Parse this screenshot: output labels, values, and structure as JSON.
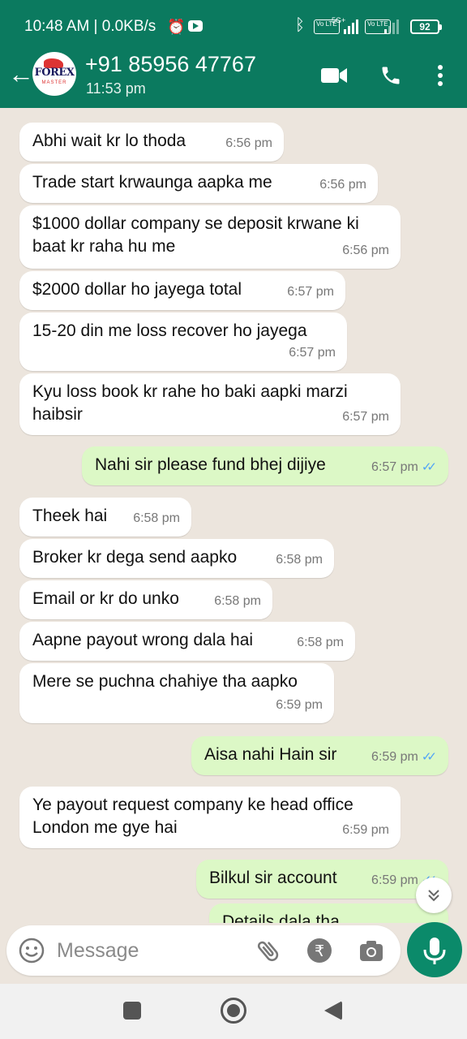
{
  "status_bar": {
    "time": "10:48 AM | 0.0KB/s",
    "network": "5G+",
    "volte1": "Vo LTE",
    "volte2": "Vo LTE",
    "battery": "92"
  },
  "header": {
    "contact_name": "+91 85956 47767",
    "last_seen": "11:53 pm",
    "avatar_logo": "FOREX",
    "avatar_sub": "MASTER"
  },
  "messages": [
    {
      "dir": "in",
      "text": "Abhi wait kr lo thoda",
      "time": "6:56 pm"
    },
    {
      "dir": "in",
      "text": "Trade start krwaunga aapka me",
      "time": "6:56 pm"
    },
    {
      "dir": "in",
      "text": "$1000 dollar company se deposit krwane ki baat kr raha hu me",
      "time": "6:56 pm"
    },
    {
      "dir": "in",
      "text": "$2000 dollar ho jayega total",
      "time": "6:57 pm"
    },
    {
      "dir": "in",
      "text": "15-20 din me loss recover ho jayega",
      "time": "6:57 pm"
    },
    {
      "dir": "in",
      "text": "Kyu loss book kr rahe ho baki aapki marzi haibsir",
      "time": "6:57 pm"
    },
    {
      "dir": "out",
      "text": "Nahi sir please fund bhej dijiye",
      "time": "6:57 pm",
      "read": true
    },
    {
      "dir": "in",
      "text": "Theek hai",
      "time": "6:58 pm"
    },
    {
      "dir": "in",
      "text": "Broker kr dega send aapko",
      "time": "6:58 pm"
    },
    {
      "dir": "in",
      "text": "Email or kr do unko",
      "time": "6:58 pm"
    },
    {
      "dir": "in",
      "text": "Aapne payout wrong dala hai",
      "time": "6:58 pm"
    },
    {
      "dir": "in",
      "text": "Mere se puchna chahiye tha aapko",
      "time": "6:59 pm"
    },
    {
      "dir": "out",
      "text": "Aisa nahi Hain sir",
      "time": "6:59 pm",
      "read": true
    },
    {
      "dir": "in",
      "text": "Ye payout request company ke head office London me gye hai",
      "time": "6:59 pm"
    },
    {
      "dir": "out",
      "text": "Bilkul sir account",
      "time": "6:59 pm",
      "read": true
    },
    {
      "dir": "out",
      "text": "Details dala tha",
      "time": ""
    }
  ],
  "composer": {
    "placeholder": "Message"
  },
  "colors": {
    "header": "#0b7a5f",
    "incoming": "#ffffff",
    "outgoing": "#dcf8c6",
    "read_ticks": "#4fa3f7",
    "mic_button": "#0b8a6a"
  }
}
